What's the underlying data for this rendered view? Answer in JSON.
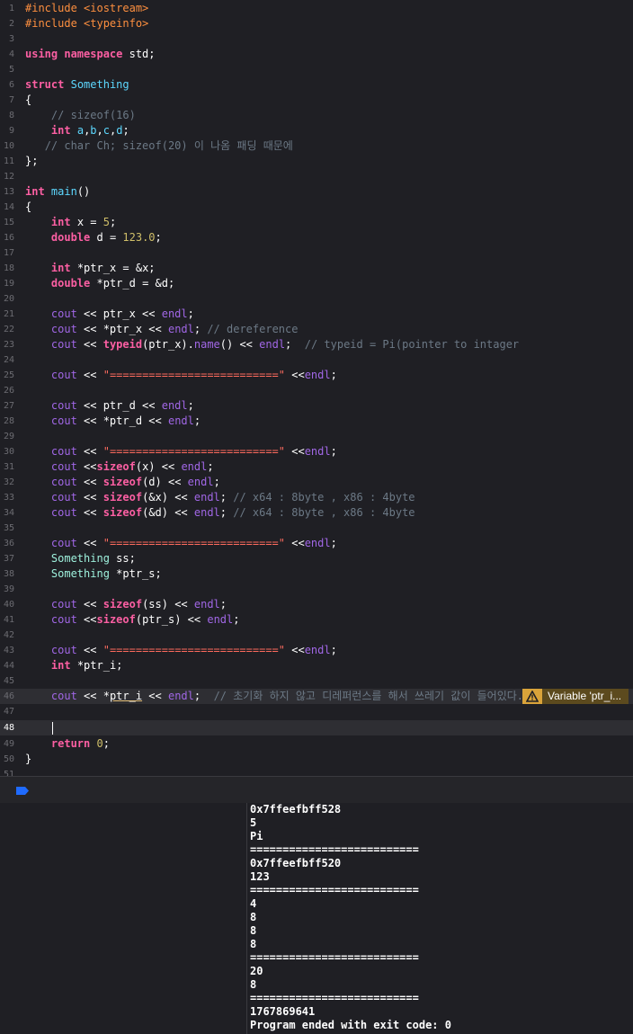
{
  "editor": {
    "line_numbers": [
      "1",
      "2",
      "3",
      "4",
      "5",
      "6",
      "7",
      "8",
      "9",
      "10",
      "11",
      "12",
      "13",
      "14",
      "15",
      "16",
      "17",
      "18",
      "19",
      "20",
      "21",
      "22",
      "23",
      "24",
      "25",
      "26",
      "27",
      "28",
      "29",
      "30",
      "31",
      "32",
      "33",
      "34",
      "35",
      "36",
      "37",
      "38",
      "39",
      "40",
      "41",
      "42",
      "43",
      "44",
      "45",
      "46",
      "47",
      "48",
      "49",
      "50",
      "51"
    ],
    "warning_text": "Variable 'ptr_i...",
    "warning_icon": "warning-triangle-icon"
  },
  "console": {
    "lines": [
      "0x7ffeefbff528",
      "5",
      "Pi",
      "==========================",
      "0x7ffeefbff520",
      "123",
      "==========================",
      "4",
      "8",
      "8",
      "8",
      "==========================",
      "20",
      "8",
      "==========================",
      "1767869641",
      "Program ended with exit code: 0"
    ]
  },
  "colors": {
    "background": "#1f1f24",
    "keyword": "#fc5fa3",
    "preprocessor": "#fd8f3f",
    "type": "#5dd8ff",
    "comment": "#6c7986",
    "string": "#fc6a5d",
    "number": "#d0bf69",
    "function": "#a167e6",
    "warning": "#d9a33a",
    "debug_icon": "#1f6bff"
  }
}
